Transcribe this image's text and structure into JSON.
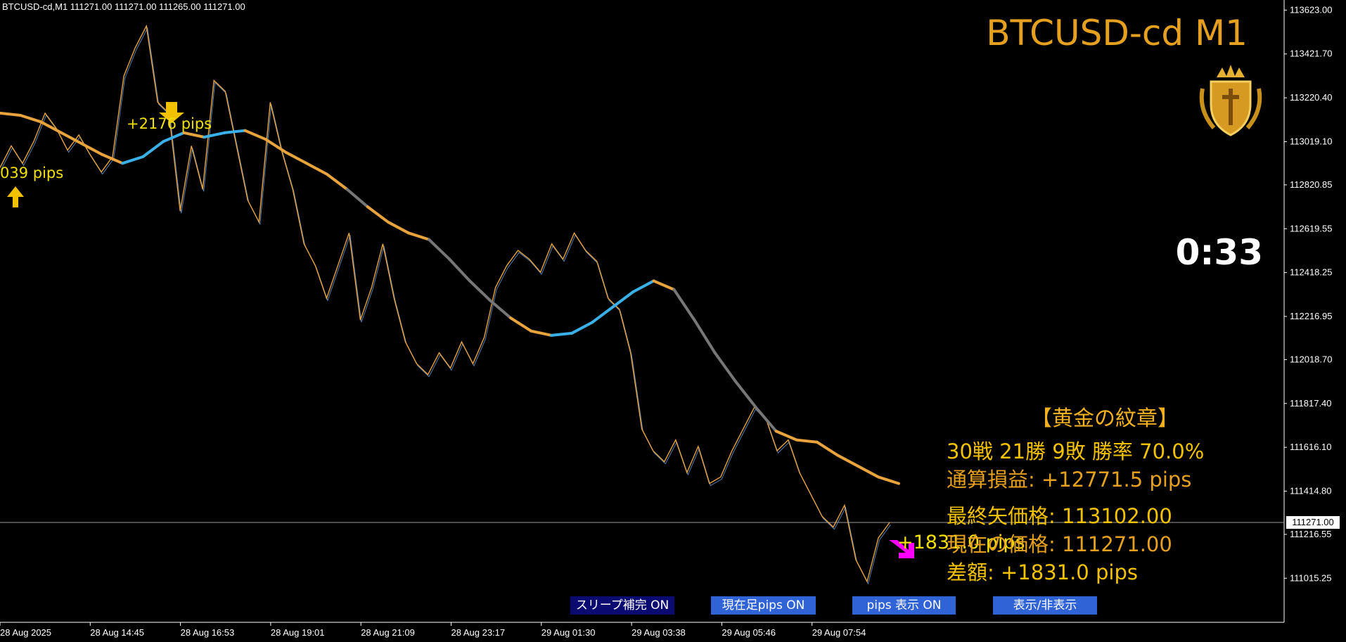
{
  "window": {
    "ohlc_header": "BTCUSD-cd,M1  111271.00 111271.00 111265.00 111271.00",
    "symbol_title": "BTCUSD-cd M1",
    "countdown": "0:33"
  },
  "stats": {
    "heading": "【黄金の紋章】",
    "record": "30戦 21勝 9敗  勝率 70.0%",
    "total_pl": "通算損益:  +12771.5 pips",
    "last_arrow_price": "最終矢価格: 113102.00",
    "current_price": "現在の価格: 111271.00",
    "difference": "差額:     +1831.0 pips"
  },
  "buttons": {
    "slip": "スリープ補完 ON",
    "bar_pips": "現在足pips ON",
    "pips_display": "pips 表示  ON",
    "toggle": "表示/非表示"
  },
  "signals": {
    "label_a": "039 pips",
    "label_b": "+2176 pips",
    "label_c": "+1831.0 pips"
  },
  "colors": {
    "price_line": "#e8a33d",
    "price_alt": "#6aa0e0",
    "ma_orange": "#e8a33d",
    "ma_blue": "#3ab0e8",
    "ma_gray": "#777777",
    "text_gold": "#f2c200",
    "text_orange": "#e6a020",
    "arrow_up": "#f2c200",
    "arrow_down": "#ff00ff"
  },
  "chart_data": {
    "type": "line",
    "title": "BTCUSD-cd M1",
    "current_price": 111271.0,
    "ylim": [
      110900,
      113650
    ],
    "y_ticks": [
      "113623.00",
      "113421.70",
      "113220.40",
      "113019.10",
      "112820.85",
      "112619.55",
      "112418.25",
      "112216.95",
      "112018.70",
      "111817.40",
      "111616.10",
      "111414.80",
      "111216.55",
      "111015.25"
    ],
    "x_ticks": [
      "28 Aug 2025",
      "28 Aug 14:45",
      "28 Aug 16:53",
      "28 Aug 19:01",
      "28 Aug 21:09",
      "28 Aug 23:17",
      "29 Aug 01:30",
      "29 Aug 03:38",
      "29 Aug 05:46",
      "29 Aug 07:54"
    ],
    "price_label": "111271.00",
    "series": [
      {
        "values": [
          112900,
          113000,
          112920,
          113020,
          113150,
          113080,
          112980,
          113050,
          112960,
          112880,
          112950,
          113320,
          113450,
          113550,
          113200,
          113150,
          112700,
          113000,
          112800,
          113300,
          113250,
          113000,
          112750,
          112650,
          113200,
          112980,
          112800,
          112550,
          112450,
          112300,
          112450,
          112600,
          112200,
          112350,
          112550,
          112300,
          112100,
          112000,
          111950,
          112050,
          111980,
          112100,
          112000,
          112120,
          112350,
          112450,
          112520,
          112480,
          112420,
          112550,
          112480,
          112600,
          112520,
          112470,
          112300,
          112250,
          112050,
          111700,
          111600,
          111550,
          111650,
          111500,
          111620,
          111450,
          111480,
          111600,
          111700,
          111800,
          111750,
          111600,
          111650,
          111500,
          111400,
          111300,
          111250,
          111350,
          111100,
          111000,
          111200,
          111271
        ]
      },
      {
        "values": [
          113150,
          113140,
          113110,
          113060,
          113010,
          112960,
          112920,
          112950,
          113020,
          113060,
          113040,
          113060,
          113070,
          113030,
          112970,
          112920,
          112870,
          112800,
          112720,
          112650,
          112600,
          112570,
          112480,
          112380,
          112290,
          112210,
          112150,
          112130,
          112140,
          112190,
          112260,
          112330,
          112380,
          112340,
          112200,
          112050,
          111920,
          111800,
          111690,
          111650,
          111640,
          111580,
          111530,
          111480,
          111450
        ]
      }
    ]
  }
}
